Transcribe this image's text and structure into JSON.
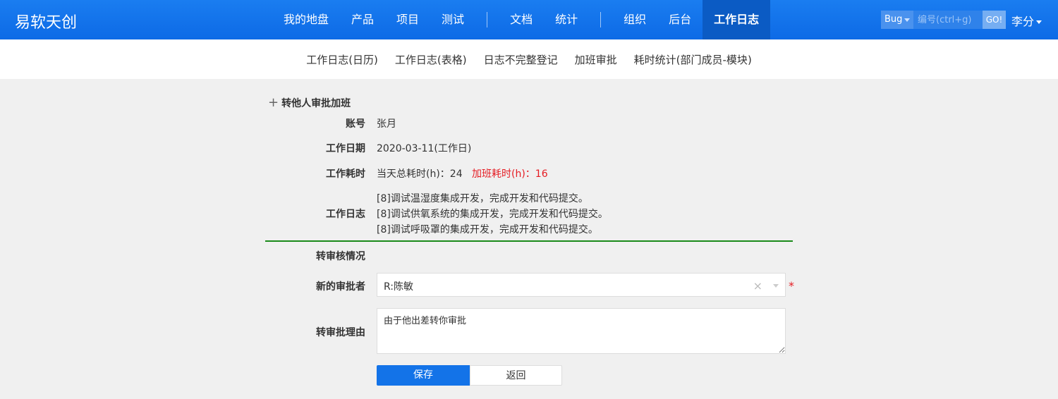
{
  "app": {
    "brand": "易软天创"
  },
  "nav": {
    "items": [
      "我的地盘",
      "产品",
      "项目",
      "测试",
      "文档",
      "统计",
      "组织",
      "后台",
      "工作日志"
    ],
    "active": "工作日志"
  },
  "search": {
    "type": "Bug",
    "placeholder": "编号(ctrl+g)",
    "go_label": "GO!"
  },
  "user": {
    "name": "李分"
  },
  "subnav": {
    "items": [
      "工作日志(日历)",
      "工作日志(表格)",
      "日志不完整登记",
      "加班审批",
      "耗时统计(部门成员-模块)"
    ]
  },
  "form": {
    "title": "转他人审批加班",
    "account": {
      "label": "账号",
      "value": "张月"
    },
    "work_date": {
      "label": "工作日期",
      "value": "2020-03-11(工作日)"
    },
    "work_time": {
      "label": "工作耗时",
      "total": "当天总耗时(h)：24",
      "overtime": "加班耗时(h)：16"
    },
    "work_log": {
      "label": "工作日志",
      "lines": [
        "[8]调试温湿度集成开发，完成开发和代码提交。",
        "[8]调试供氧系统的集成开发，完成开发和代码提交。",
        "[8]调试呼吸罩的集成开发，完成开发和代码提交。"
      ]
    },
    "transfer_status": {
      "label": "转审核情况"
    },
    "new_approver": {
      "label": "新的审批者",
      "value": "R:陈敏"
    },
    "reason": {
      "label": "转审批理由",
      "value": "由于他出差转你审批"
    },
    "save_label": "保存",
    "back_label": "返回"
  },
  "colors": {
    "topbar": "#0d6ae6",
    "accent": "#1373e8",
    "overtime": "#e51c23",
    "divider": "#1a8a1a"
  }
}
